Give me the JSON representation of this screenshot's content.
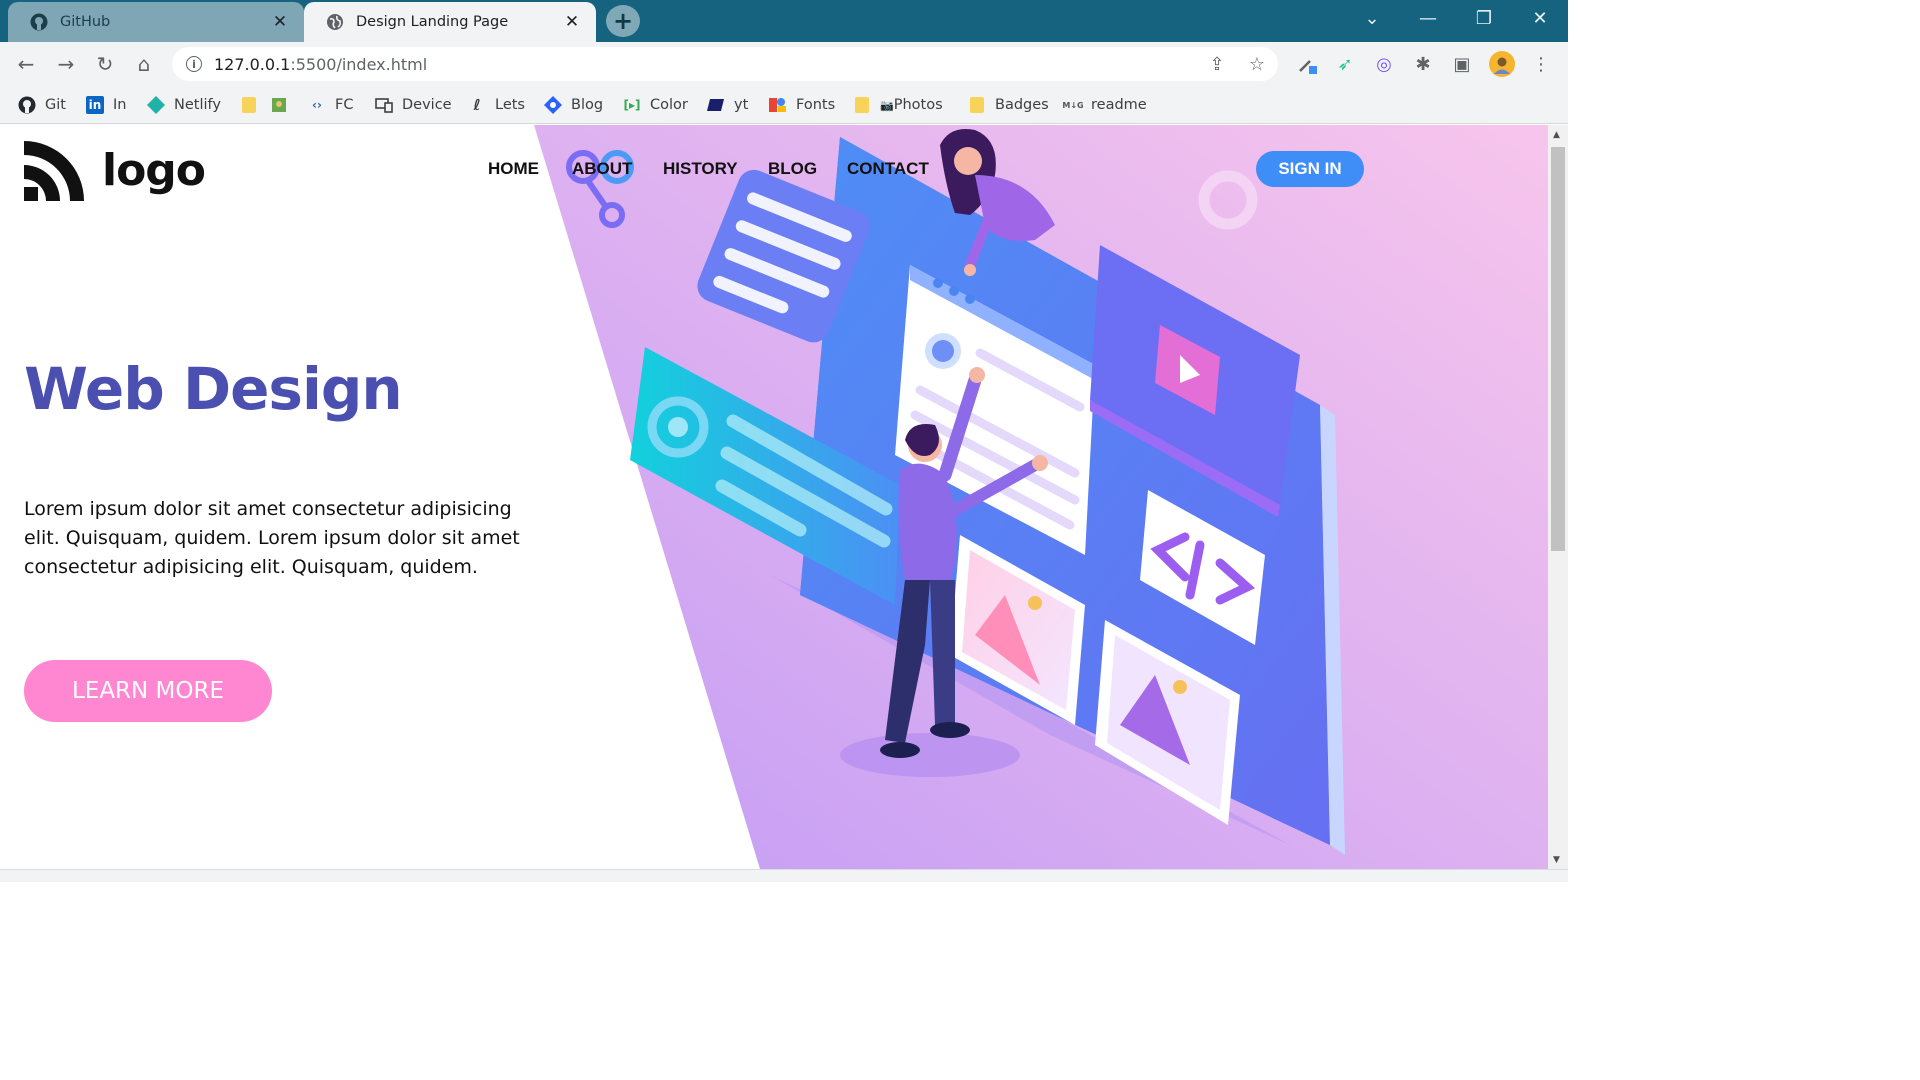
{
  "browser": {
    "tabs": [
      {
        "title": "GitHub",
        "icon": "github-icon"
      },
      {
        "title": "Design Landing Page",
        "icon": "globe-icon"
      }
    ],
    "url_host": "127.0.0.1",
    "url_path": ":5500/index.html",
    "bookmarks": [
      {
        "label": "Git",
        "icon": "github-icon"
      },
      {
        "label": "In",
        "icon": "linkedin-icon"
      },
      {
        "label": "Netlify",
        "icon": "netlify-icon"
      },
      {
        "label": "",
        "icon": "folder-icon"
      },
      {
        "label": "",
        "icon": "image-icon"
      },
      {
        "label": "FC",
        "icon": "code-icon"
      },
      {
        "label": "Device",
        "icon": "device-icon"
      },
      {
        "label": "Lets",
        "icon": "lets-icon"
      },
      {
        "label": "Blog",
        "icon": "blog-icon"
      },
      {
        "label": "Color",
        "icon": "color-icon"
      },
      {
        "label": "yt",
        "icon": "yt-icon"
      },
      {
        "label": "Fonts",
        "icon": "fonts-icon"
      },
      {
        "label": "Photos",
        "icon": "folder-icon"
      },
      {
        "label": "Badges",
        "icon": "folder-icon"
      },
      {
        "label": "readme",
        "icon": "readme-icon"
      }
    ],
    "photos_prefix": "📷"
  },
  "page": {
    "logo_text": "logo",
    "nav": [
      "HOME",
      "ABOUT",
      "HISTORY",
      "BLOG",
      "CONTACT"
    ],
    "signin": "SIGN IN",
    "heading": "Web Design",
    "paragraph": "Lorem ipsum dolor sit amet consectetur adipisicing elit. Quisquam, quidem. Lorem ipsum dolor sit amet consectetur adipisicing elit. Quisquam, quidem.",
    "cta": "LEARN MORE"
  },
  "colors": {
    "tabbar": "#16637f",
    "heading": "#4a4fb0",
    "signin": "#3f8df6",
    "cta": "#ff86d0",
    "hero_gradient_start": "#c49df5",
    "hero_gradient_end": "#f7c5ec"
  }
}
